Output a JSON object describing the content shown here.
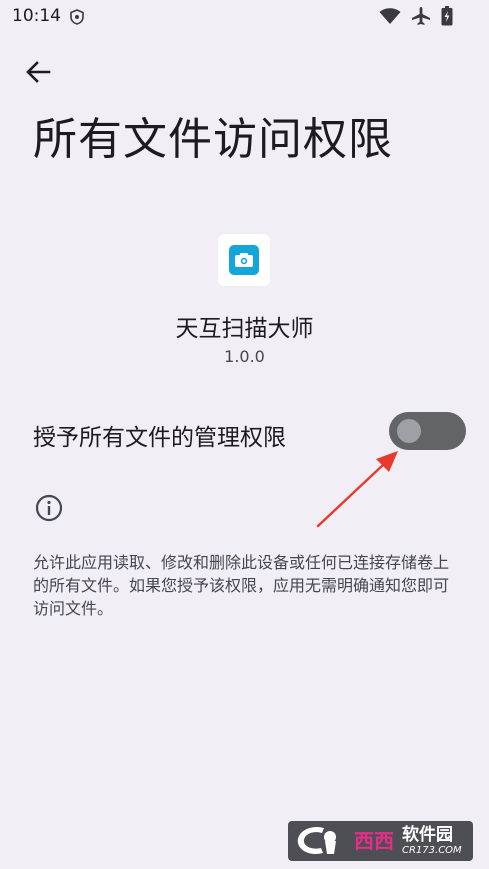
{
  "status_bar": {
    "time": "10:14",
    "icons": [
      "shield-icon",
      "wifi-icon",
      "airplane-icon",
      "battery-icon"
    ]
  },
  "header": {
    "back_icon": "arrow-left-icon",
    "title": "所有文件访问权限"
  },
  "app": {
    "name": "天互扫描大师",
    "version": "1.0.0",
    "icon": "camera-icon",
    "icon_color": "#14a6d8"
  },
  "permission": {
    "label": "授予所有文件的管理权限",
    "enabled": false
  },
  "info": {
    "icon": "info-icon",
    "description": "允许此应用读取、修改和删除此设备或任何已连接存储卷上的所有文件。如果您授予该权限，应用无需明确通知您即可访问文件。"
  },
  "watermark": {
    "name": "西西",
    "title": "软件园",
    "url": "CR173.COM"
  },
  "colors": {
    "background": "#f1eff5",
    "toggle_track": "#626466",
    "toggle_thumb": "#9ea0a6",
    "annotation_arrow": "#e8392c"
  }
}
